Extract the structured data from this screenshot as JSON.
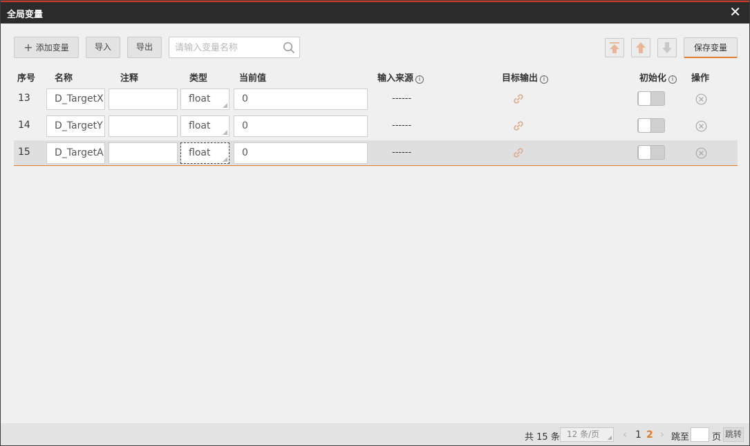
{
  "window": {
    "title": "全局变量",
    "close": "✕"
  },
  "toolbar": {
    "add_label": "添加变量",
    "import_label": "导入",
    "export_label": "导出",
    "search_placeholder": "请输入变量名称",
    "save_label": "保存变量"
  },
  "columns": {
    "index": "序号",
    "name": "名称",
    "comment": "注释",
    "type": "类型",
    "value": "当前值",
    "input_source": "输入来源",
    "target_output": "目标输出",
    "init": "初始化",
    "action": "操作"
  },
  "rows": [
    {
      "index": "13",
      "name": "D_TargetX",
      "comment": "",
      "type": "float",
      "value": "0",
      "input_source": "------",
      "init_enabled": false
    },
    {
      "index": "14",
      "name": "D_TargetY",
      "comment": "",
      "type": "float",
      "value": "0",
      "input_source": "------",
      "init_enabled": false
    },
    {
      "index": "15",
      "name": "D_TargetA",
      "comment": "",
      "type": "float",
      "value": "0",
      "input_source": "------",
      "init_enabled": false,
      "selected": true
    }
  ],
  "footer": {
    "total_prefix": "共",
    "total_count": "15",
    "total_suffix": "条",
    "page_size": "12 条/页",
    "pages": [
      "1",
      "2"
    ],
    "current_page": "2",
    "jump_label": "跳至",
    "page_unit": "页",
    "jump_button": "跳转",
    "prev": "‹",
    "next": "›"
  },
  "colors": {
    "accent": "#e07b2a",
    "title_bar": "#2b2b2b",
    "title_top_line": "#d33b2c"
  }
}
